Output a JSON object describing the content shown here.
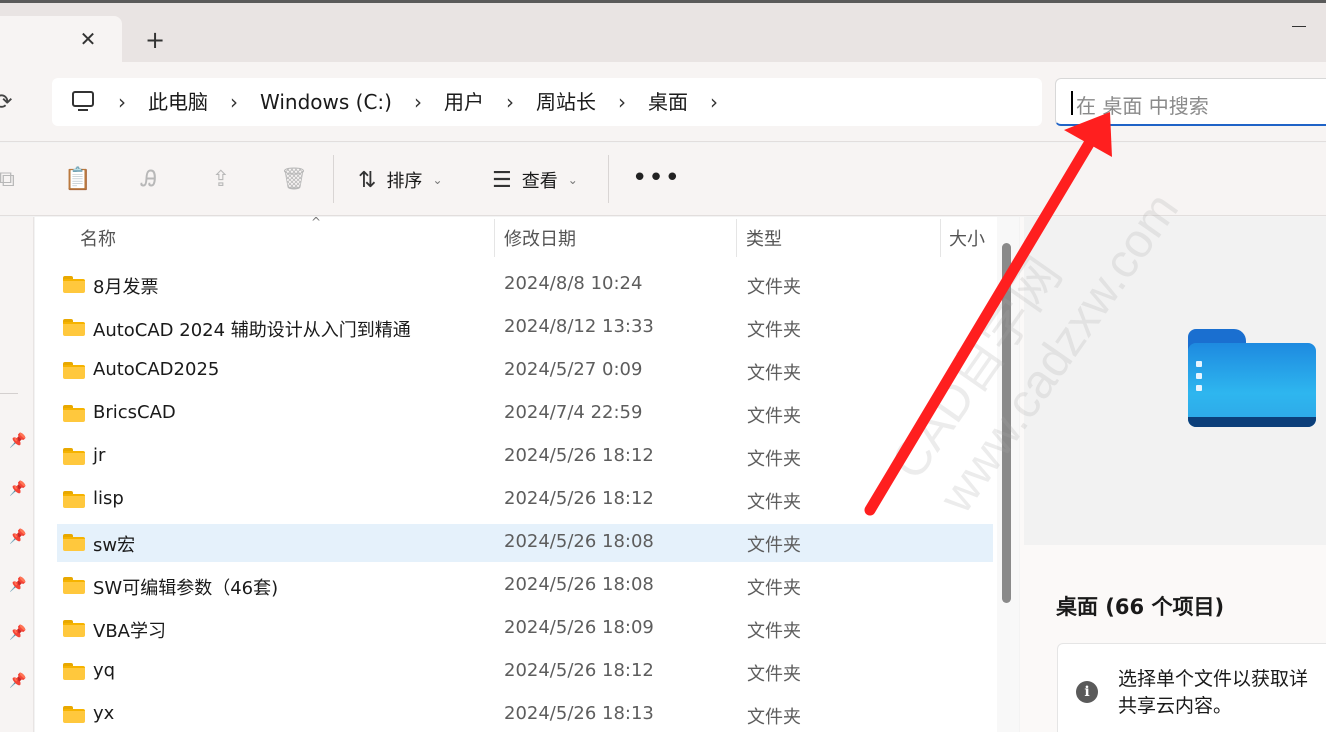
{
  "tabs": {
    "close_glyph": "✕",
    "new_tab_glyph": "+"
  },
  "address": {
    "breadcrumb": [
      "此电脑",
      "Windows (C:)",
      "用户",
      "周站长",
      "桌面"
    ],
    "search_placeholder": "在 桌面 中搜索"
  },
  "toolbar": {
    "sort_label": "排序",
    "view_label": "查看",
    "more_label": "•••"
  },
  "columns": {
    "name": "名称",
    "modified": "修改日期",
    "type": "类型",
    "size": "大小"
  },
  "files": [
    {
      "name": "8月发票",
      "modified": "2024/8/8 10:24",
      "type": "文件夹"
    },
    {
      "name": "AutoCAD 2024 辅助设计从入门到精通",
      "modified": "2024/8/12 13:33",
      "type": "文件夹"
    },
    {
      "name": "AutoCAD2025",
      "modified": "2024/5/27 0:09",
      "type": "文件夹"
    },
    {
      "name": "BricsCAD",
      "modified": "2024/7/4 22:59",
      "type": "文件夹"
    },
    {
      "name": "jr",
      "modified": "2024/5/26 18:12",
      "type": "文件夹"
    },
    {
      "name": "lisp",
      "modified": "2024/5/26 18:12",
      "type": "文件夹"
    },
    {
      "name": "sw宏",
      "modified": "2024/5/26 18:08",
      "type": "文件夹",
      "selected": true
    },
    {
      "name": "SW可编辑参数（46套)",
      "modified": "2024/5/26 18:08",
      "type": "文件夹"
    },
    {
      "name": "VBA学习",
      "modified": "2024/5/26 18:09",
      "type": "文件夹"
    },
    {
      "name": "yq",
      "modified": "2024/5/26 18:12",
      "type": "文件夹"
    },
    {
      "name": "yx",
      "modified": "2024/5/26 18:13",
      "type": "文件夹"
    }
  ],
  "details": {
    "title": "桌面 (66 个项目)",
    "info_line1": "选择单个文件以获取详",
    "info_line2": "共享云内容。"
  },
  "watermark": {
    "line1": "CAD自学网",
    "line2": "www.cadzxw.com"
  },
  "colors": {
    "accent": "#1f63c7",
    "selection": "#e5f1fb",
    "annotation_arrow": "#ff1f1f",
    "folder": "#ffc83d"
  }
}
